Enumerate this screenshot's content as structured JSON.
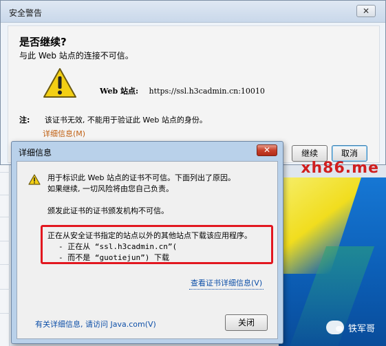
{
  "main_dialog": {
    "title": "安全警告",
    "close_glyph": "✕",
    "headline": "是否继续?",
    "subline": "与此 Web 站点的连接不可信。",
    "site_label": "Web 站点:",
    "site_url": "https://ssl.h3cadmin.cn:10010",
    "note_label": "注:",
    "note_text": "该证书无效, 不能用于验证此 Web 站点的身份。",
    "more_info_link": "详细信息(M)",
    "continue_label": "继续",
    "cancel_label": "取消"
  },
  "details_dialog": {
    "title": "详细信息",
    "close_glyph": "✕",
    "line1": "用于标识此 Web 站点的证书不可信。下面列出了原因。",
    "line2": "如果继续, 一切风险将由您自己负责。",
    "line3": "颁发此证书的证书颁发机构不可信。",
    "boxed_line1": "正在从安全证书指定的站点以外的其他站点下载该应用程序。",
    "boxed_line2": "- 正在从 “ssl.h3cadmin.cn”(",
    "boxed_line3": "- 而不是 “guotiejun”) 下载",
    "view_cert_link": "查看证书详细信息(V)",
    "more_info_link": "有关详细信息, 请访问 Java.com(V)",
    "close_label": "关闭"
  },
  "watermark": {
    "site": "xh86.me",
    "author": "铁军哥"
  },
  "icons": {
    "warning": "warning-triangle-icon",
    "chat": "wechat-icon"
  },
  "colors": {
    "highlight_box": "#e2171f",
    "watermark": "#d01f1f",
    "link": "#0d4fa8",
    "more_info": "#c06012"
  }
}
